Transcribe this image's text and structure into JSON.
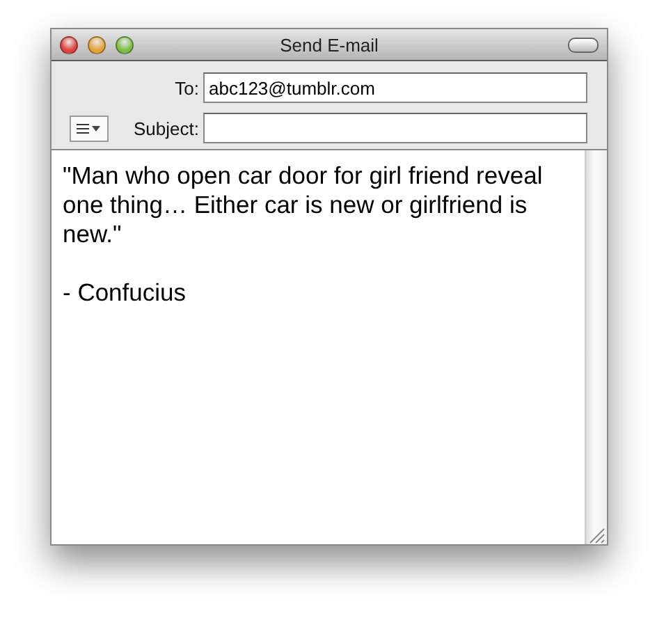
{
  "window": {
    "title": "Send E-mail"
  },
  "fields": [
    {
      "label": "To:",
      "value": "abc123@tumblr.com"
    },
    {
      "label": "Subject:"
    }
  ],
  "body": "\"Man who open car door for girl friend reveal one thing… Either car is new or girlfriend is new.\"\n\n- Confucius"
}
